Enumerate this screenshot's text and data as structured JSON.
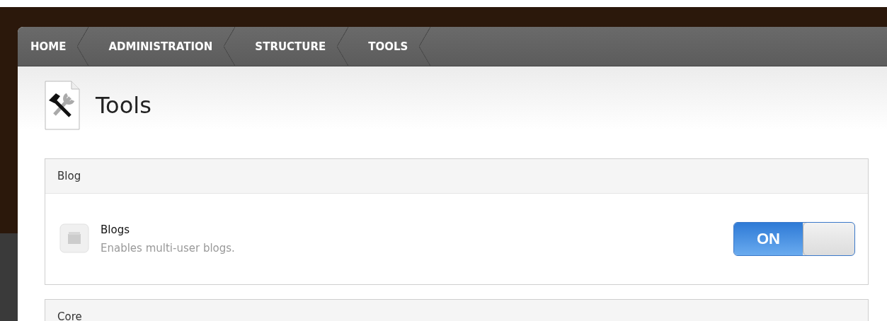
{
  "breadcrumbs": [
    {
      "label": "HOME"
    },
    {
      "label": "ADMINISTRATION"
    },
    {
      "label": "STRUCTURE"
    },
    {
      "label": "TOOLS"
    }
  ],
  "page": {
    "title": "Tools"
  },
  "sections": [
    {
      "title": "Blog",
      "modules": [
        {
          "name": "Blogs",
          "description": "Enables multi-user blogs.",
          "on": true,
          "toggle_label": "ON"
        }
      ]
    },
    {
      "title": "Core"
    }
  ]
}
